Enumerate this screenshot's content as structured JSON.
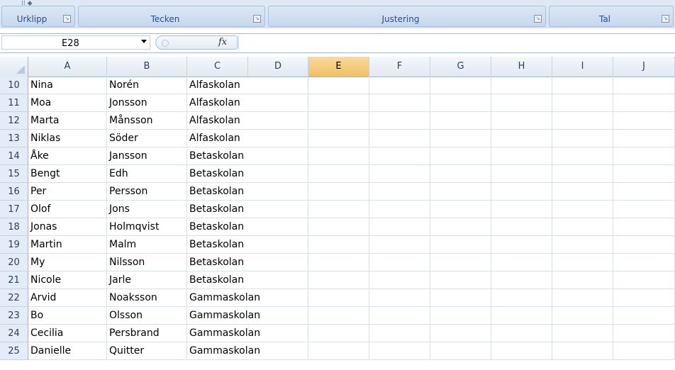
{
  "ribbon": {
    "groups": [
      {
        "label": "Urklipp"
      },
      {
        "label": "Tecken"
      },
      {
        "label": "Justering"
      },
      {
        "label": "Tal"
      }
    ]
  },
  "formula_bar": {
    "name_box": "E28",
    "fx_label": "fx",
    "formula": ""
  },
  "columns": [
    "A",
    "B",
    "C",
    "D",
    "E",
    "F",
    "G",
    "H",
    "I",
    "J"
  ],
  "selected_column": "E",
  "rows": [
    {
      "num": "10",
      "a": "Nina",
      "b": "Norén",
      "c": "Alfaskolan"
    },
    {
      "num": "11",
      "a": "Moa",
      "b": "Jonsson",
      "c": "Alfaskolan"
    },
    {
      "num": "12",
      "a": "Marta",
      "b": "Månsson",
      "c": "Alfaskolan"
    },
    {
      "num": "13",
      "a": "Niklas",
      "b": "Söder",
      "c": "Alfaskolan"
    },
    {
      "num": "14",
      "a": "Åke",
      "b": "Jansson",
      "c": "Betaskolan"
    },
    {
      "num": "15",
      "a": "Bengt",
      "b": "Edh",
      "c": "Betaskolan"
    },
    {
      "num": "16",
      "a": "Per",
      "b": "Persson",
      "c": "Betaskolan"
    },
    {
      "num": "17",
      "a": "Olof",
      "b": "Jons",
      "c": "Betaskolan"
    },
    {
      "num": "18",
      "a": "Jonas",
      "b": "Holmqvist",
      "c": "Betaskolan"
    },
    {
      "num": "19",
      "a": "Martin",
      "b": "Malm",
      "c": "Betaskolan"
    },
    {
      "num": "20",
      "a": "My",
      "b": "Nilsson",
      "c": "Betaskolan"
    },
    {
      "num": "21",
      "a": "Nicole",
      "b": "Jarle",
      "c": "Betaskolan"
    },
    {
      "num": "22",
      "a": "Arvid",
      "b": "Noaksson",
      "c": "Gammaskolan"
    },
    {
      "num": "23",
      "a": "Bo",
      "b": "Olsson",
      "c": "Gammaskolan"
    },
    {
      "num": "24",
      "a": "Cecilia",
      "b": "Persbrand",
      "c": "Gammaskolan"
    },
    {
      "num": "25",
      "a": "Danielle",
      "b": "Quitter",
      "c": "Gammaskolan"
    }
  ]
}
